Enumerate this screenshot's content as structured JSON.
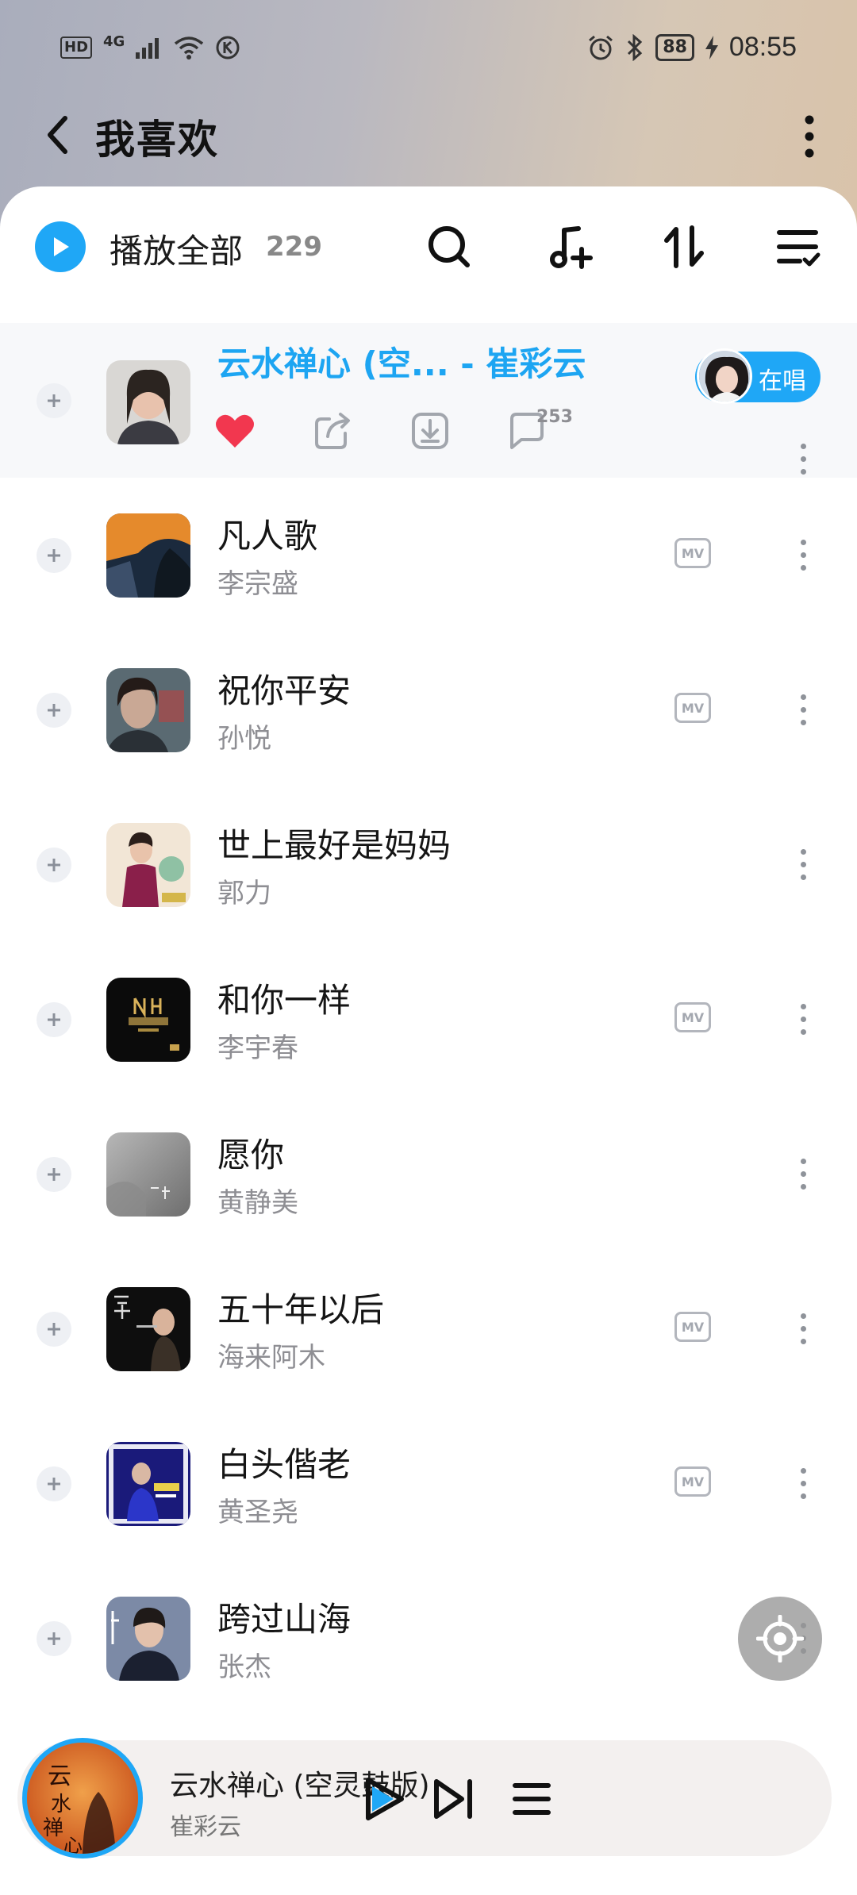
{
  "status_bar": {
    "hd": "HD",
    "network": "4G",
    "battery": "88",
    "time": "08:55"
  },
  "header": {
    "title": "我喜欢"
  },
  "toolbar": {
    "play_all_label": "播放全部",
    "count": "229"
  },
  "current_song": {
    "title": "云水禅心 (空... - 崔彩云",
    "singing_label": "在唱",
    "comment_count": "253",
    "liked": true
  },
  "songs": [
    {
      "title": "凡人歌",
      "artist": "李宗盛",
      "mv": true,
      "mv_label": "MV"
    },
    {
      "title": "祝你平安",
      "artist": "孙悦",
      "mv": true,
      "mv_label": "MV"
    },
    {
      "title": "世上最好是妈妈",
      "artist": "郭力",
      "mv": false
    },
    {
      "title": "和你一样",
      "artist": "李宇春",
      "mv": true,
      "mv_label": "MV"
    },
    {
      "title": "愿你",
      "artist": "黄静美",
      "mv": false
    },
    {
      "title": "五十年以后",
      "artist": "海来阿木",
      "mv": true,
      "mv_label": "MV"
    },
    {
      "title": "白头偕老",
      "artist": "黄圣尧",
      "mv": true,
      "mv_label": "MV"
    },
    {
      "title": "跨过山海",
      "artist": "张杰",
      "mv": false
    }
  ],
  "player": {
    "title": "云水禅心 (空灵鼓版)",
    "artist": "崔彩云",
    "cover_text": "云水禅心"
  },
  "colors": {
    "accent": "#1fa7f6",
    "like": "#f2374f"
  }
}
